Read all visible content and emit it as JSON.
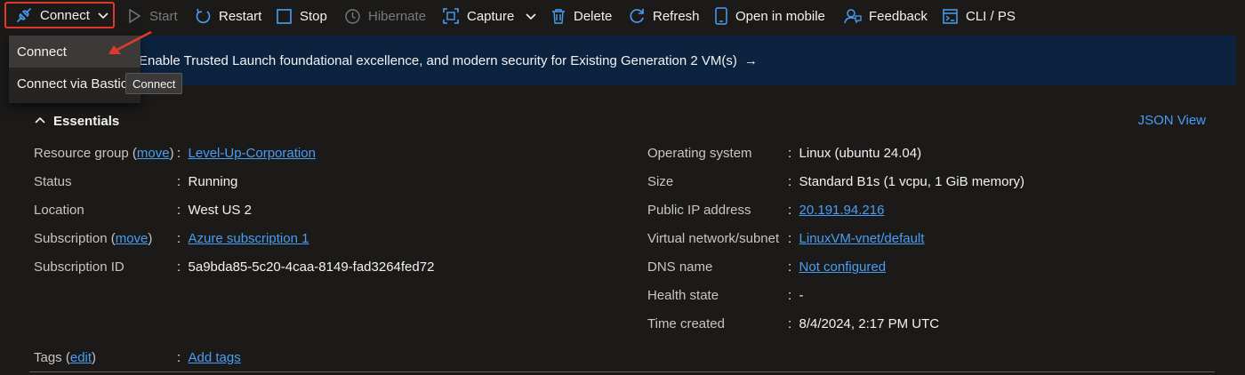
{
  "toolbar": {
    "connect": "Connect",
    "start": "Start",
    "restart": "Restart",
    "stop": "Stop",
    "hibernate": "Hibernate",
    "capture": "Capture",
    "delete": "Delete",
    "refresh": "Refresh",
    "open_mobile": "Open in mobile",
    "feedback": "Feedback",
    "cli": "CLI / PS"
  },
  "banner": {
    "text": "Enable Trusted Launch foundational excellence, and modern security for Existing Generation 2 VM(s)",
    "arrow": "→"
  },
  "dropdown": {
    "items": [
      "Connect",
      "Connect via Bastion"
    ],
    "tooltip": "Connect"
  },
  "essentials": {
    "title": "Essentials",
    "json_view": "JSON View",
    "left": {
      "resource_group_label": "Resource group",
      "resource_group_move": "move",
      "resource_group": "Level-Up-Corporation",
      "status_label": "Status",
      "status": "Running",
      "location_label": "Location",
      "location": "West US 2",
      "subscription_label": "Subscription",
      "subscription_move": "move",
      "subscription": "Azure subscription 1",
      "subscription_id_label": "Subscription ID",
      "subscription_id": "5a9bda85-5c20-4caa-8149-fad3264fed72"
    },
    "right": {
      "os_label": "Operating system",
      "os": "Linux (ubuntu 24.04)",
      "size_label": "Size",
      "size": "Standard B1s (1 vcpu, 1 GiB memory)",
      "ip_label": "Public IP address",
      "ip": "20.191.94.216",
      "vnet_label": "Virtual network/subnet",
      "vnet": "LinuxVM-vnet/default",
      "dns_label": "DNS name",
      "dns": "Not configured",
      "health_label": "Health state",
      "health": "-",
      "time_label": "Time created",
      "time": "8/4/2024, 2:17 PM UTC"
    },
    "tags_label": "Tags",
    "tags_edit": "edit",
    "tags_value": "Add tags"
  },
  "colors": {
    "accent": "#479ef5",
    "banner_bg": "#0c2340",
    "highlight": "#e0392b"
  }
}
